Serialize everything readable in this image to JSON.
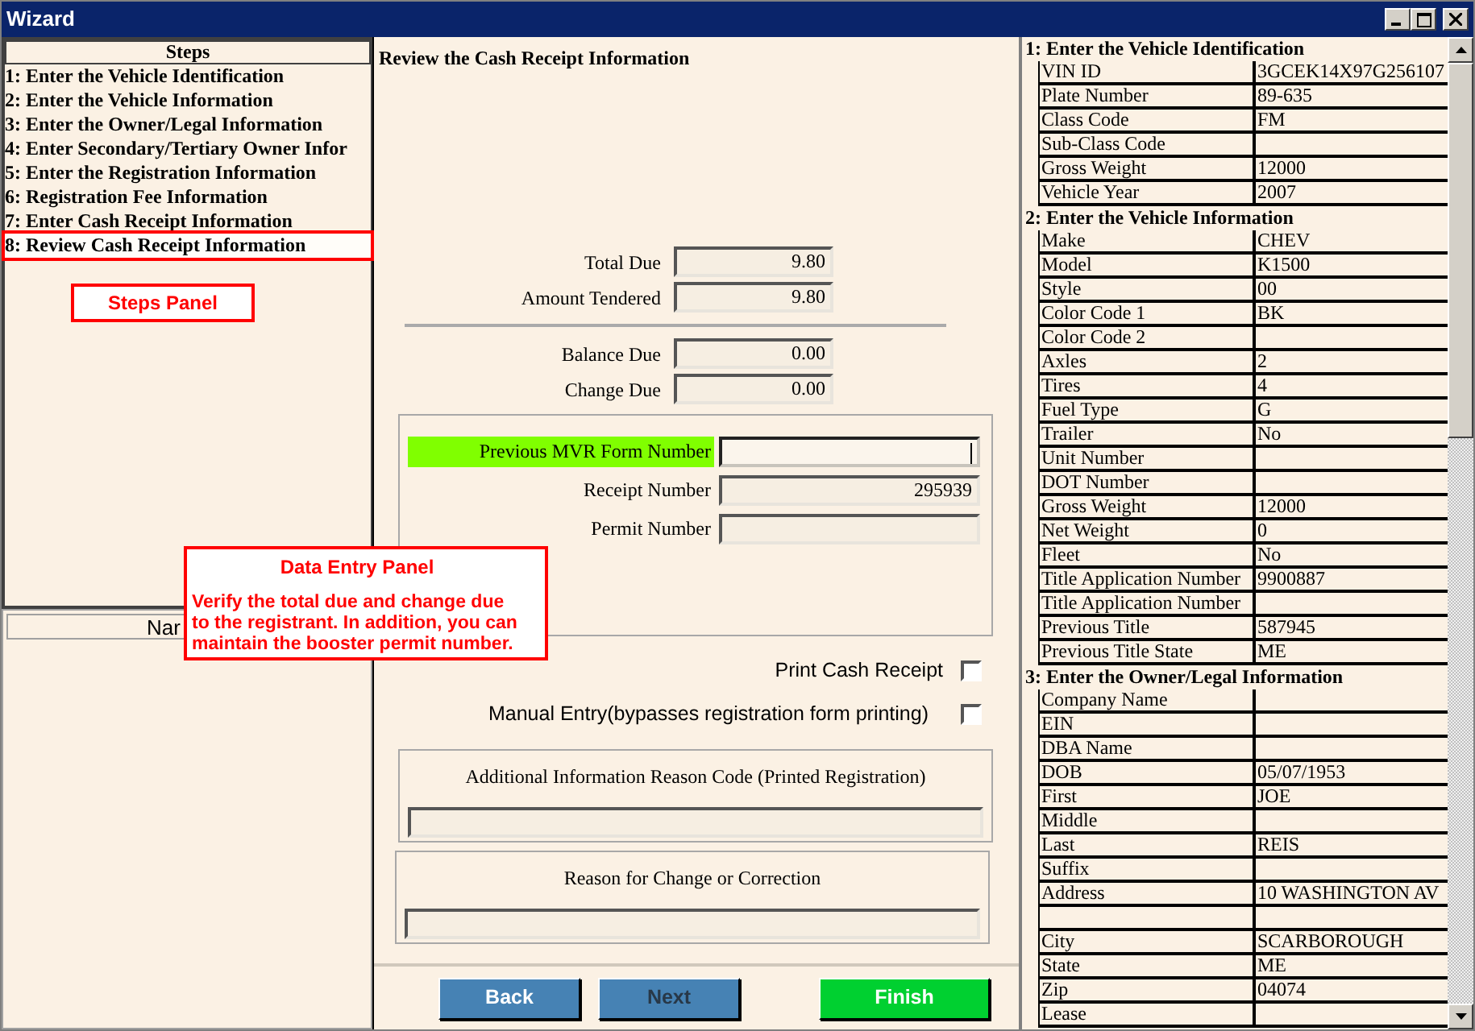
{
  "window": {
    "title": "Wizard"
  },
  "steps_panel": {
    "header": "Steps",
    "items": [
      {
        "label": "1: Enter the Vehicle Identification",
        "selected": false,
        "annotated": false
      },
      {
        "label": "2: Enter the Vehicle Information",
        "selected": false,
        "annotated": false
      },
      {
        "label": "3: Enter the Owner/Legal Information",
        "selected": false,
        "annotated": false
      },
      {
        "label": "4: Enter  Secondary/Tertiary Owner Infor",
        "selected": false,
        "annotated": false
      },
      {
        "label": "5: Enter the Registration Information",
        "selected": false,
        "annotated": false
      },
      {
        "label": "6: Registration Fee Information",
        "selected": false,
        "annotated": false
      },
      {
        "label": "7: Enter Cash Receipt Information",
        "selected": false,
        "annotated": false
      },
      {
        "label": "8: Review Cash Receipt Information",
        "selected": true,
        "annotated": true
      }
    ]
  },
  "lower_left_panel": {
    "header": "Nar"
  },
  "callouts": [
    {
      "title": "Steps Panel"
    },
    {
      "title": "Data Entry Panel",
      "text": "Verify the total due and change due to the registrant.  In addition, you can maintain the booster permit number."
    }
  ],
  "form": {
    "title": "Review the Cash Receipt Information",
    "amounts": [
      {
        "label": "Total Due",
        "value": "9.80"
      },
      {
        "label": "Amount Tendered",
        "value": "9.80"
      }
    ],
    "balances": [
      {
        "label": "Balance Due",
        "value": "0.00"
      },
      {
        "label": "Change Due",
        "value": "0.00"
      }
    ],
    "numbers": [
      {
        "label": "Previous MVR Form Number",
        "highlighted": true,
        "focused": true
      },
      {
        "label": "Receipt Number",
        "value": "295939",
        "highlighted": false,
        "focused": false
      },
      {
        "label": "Permit Number",
        "highlighted": false,
        "focused": false
      }
    ],
    "checkboxes": [
      {
        "label": "Print Cash Receipt",
        "checked": false
      },
      {
        "label": "Manual Entry(bypasses registration form printing)",
        "checked": false
      }
    ],
    "reason_groups": [
      {
        "label": "Additional Information Reason Code (Printed Registration)"
      },
      {
        "label": "Reason for Change or Correction"
      }
    ]
  },
  "buttons": [
    {
      "label": "Back",
      "kind": "nav",
      "disabled": false
    },
    {
      "label": "Next",
      "kind": "nav",
      "disabled": true
    },
    {
      "label": "Finish",
      "kind": "finish",
      "disabled": false
    }
  ],
  "summary": {
    "sections": [
      {
        "title": "1: Enter the Vehicle Identification",
        "rows": [
          {
            "label": "VIN ID",
            "value": "3GCEK14X97G256107"
          },
          {
            "label": "Plate Number",
            "value": "89-635"
          },
          {
            "label": "Class Code",
            "value": "FM"
          },
          {
            "label": "Sub-Class Code"
          },
          {
            "label": "Gross Weight",
            "value": "12000"
          },
          {
            "label": "Vehicle Year",
            "value": "2007"
          }
        ]
      },
      {
        "title": "2: Enter the Vehicle Information",
        "rows": [
          {
            "label": "Make",
            "value": "CHEV"
          },
          {
            "label": "Model",
            "value": "K1500"
          },
          {
            "label": "Style",
            "value": "00"
          },
          {
            "label": "Color Code 1",
            "value": "BK"
          },
          {
            "label": "Color Code 2"
          },
          {
            "label": "Axles",
            "value": "2"
          },
          {
            "label": "Tires",
            "value": "4"
          },
          {
            "label": "Fuel Type",
            "value": "G"
          },
          {
            "label": "Trailer",
            "value": "No"
          },
          {
            "label": "Unit Number"
          },
          {
            "label": "DOT Number"
          },
          {
            "label": "Gross Weight",
            "value": "12000"
          },
          {
            "label": "Net Weight",
            "value": "0"
          },
          {
            "label": "Fleet",
            "value": "No"
          },
          {
            "label": "Title Application Number",
            "value": "9900887"
          },
          {
            "label": "Title Application Number"
          },
          {
            "label": "Previous Title",
            "value": "587945"
          },
          {
            "label": "Previous Title State",
            "value": "ME"
          }
        ]
      },
      {
        "title": "3: Enter the Owner/Legal Information",
        "rows": [
          {
            "label": "Company  Name"
          },
          {
            "label": "EIN"
          },
          {
            "label": "DBA Name"
          },
          {
            "label": "DOB",
            "value": "05/07/1953"
          },
          {
            "label": "First",
            "value": "JOE"
          },
          {
            "label": "Middle"
          },
          {
            "label": "Last",
            "value": "REIS"
          },
          {
            "label": "Suffix"
          },
          {
            "label": "Address",
            "value": "10 WASHINGTON AV"
          },
          {},
          {
            "label": "City",
            "value": "SCARBOROUGH"
          },
          {
            "label": "State",
            "value": "ME"
          },
          {
            "label": "Zip",
            "value": "04074"
          },
          {
            "label": "Lease"
          }
        ]
      }
    ]
  }
}
